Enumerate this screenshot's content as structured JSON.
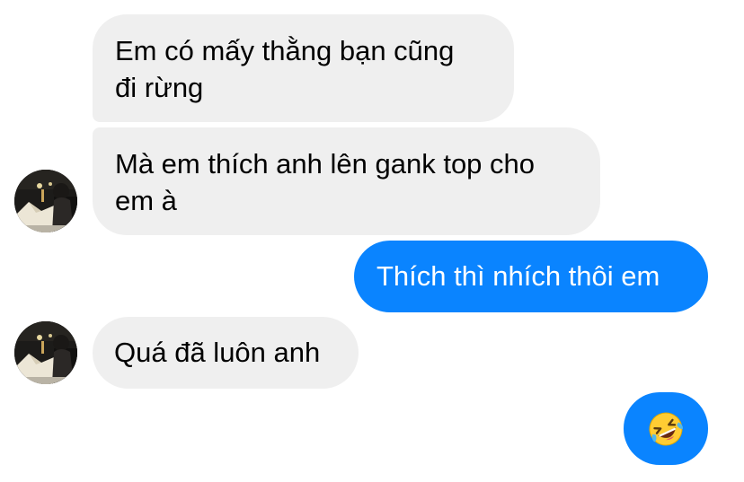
{
  "messages": [
    {
      "direction": "incoming",
      "lines": [
        "Em có mấy thằng bạn cũng",
        "đi rừng"
      ]
    },
    {
      "direction": "incoming",
      "lines": [
        "Mà em thích anh lên gank top cho",
        "em à"
      ]
    },
    {
      "direction": "outgoing",
      "text": "Thích thì nhích thôi em"
    },
    {
      "direction": "incoming",
      "text": "Quá đã luôn anh"
    },
    {
      "direction": "outgoing",
      "emoji": "rolling-on-the-floor-laughing"
    }
  ],
  "colors": {
    "incoming_bubble": "#efefef",
    "outgoing_bubble": "#0a84ff",
    "incoming_text": "#000000",
    "outgoing_text": "#ffffff"
  },
  "icons": {
    "avatar": "contact-avatar-photo",
    "reaction_emoji": "rolling-on-the-floor-laughing-emoji"
  }
}
